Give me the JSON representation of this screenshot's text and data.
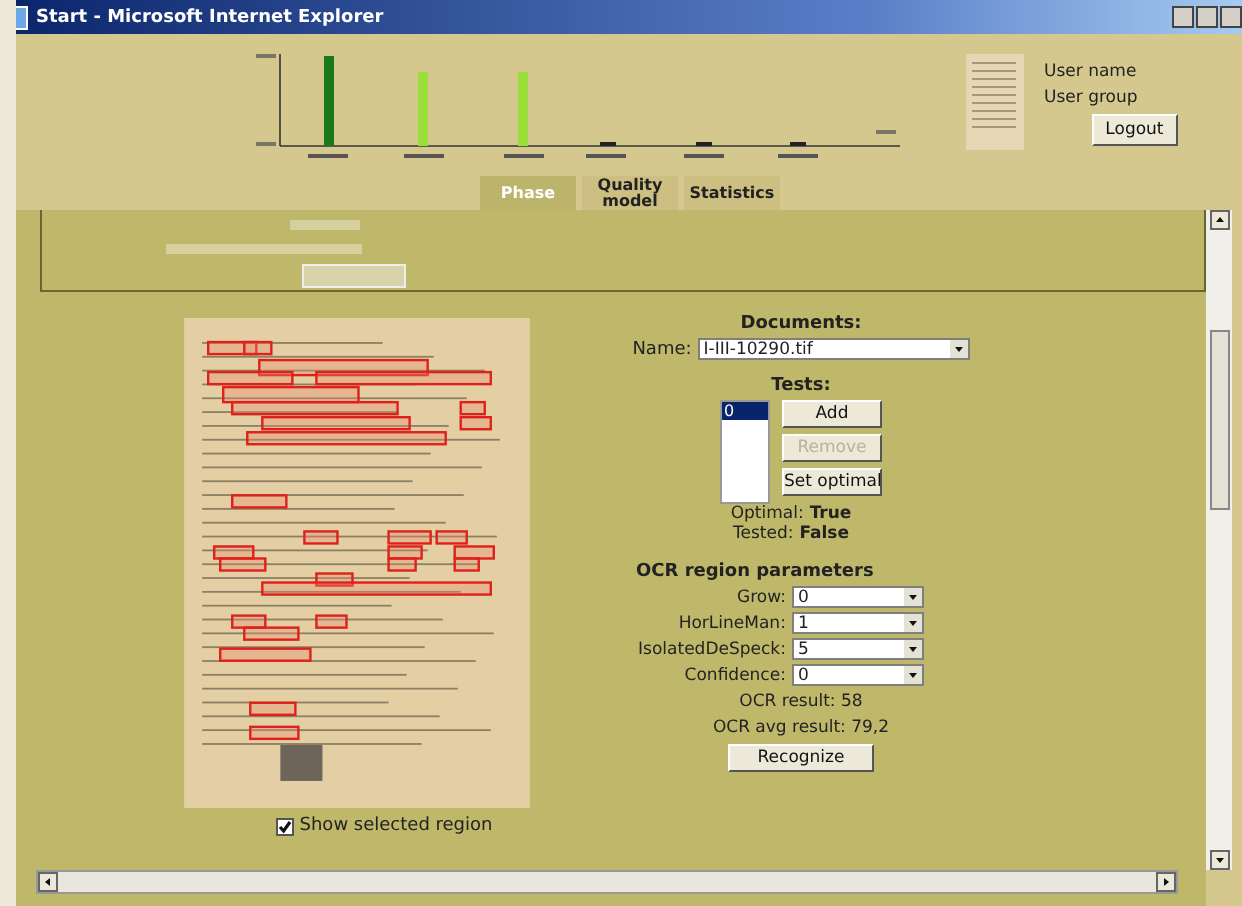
{
  "window": {
    "title": "Start - Microsoft Internet Explorer"
  },
  "header": {
    "user_name": "User name",
    "user_group": "User group",
    "logout": "Logout"
  },
  "tabs": [
    {
      "label": "Phase",
      "selected": true
    },
    {
      "label": "Quality model",
      "selected": false
    },
    {
      "label": "Statistics",
      "selected": false
    }
  ],
  "documents": {
    "heading": "Documents:",
    "name_label": "Name:",
    "name_value": "I-III-10290.tif"
  },
  "tests": {
    "heading": "Tests:",
    "items": [
      {
        "label": "0",
        "selected": true
      }
    ],
    "buttons": [
      {
        "label": "Add",
        "disabled": false
      },
      {
        "label": "Remove",
        "disabled": true
      },
      {
        "label": "Set optimal",
        "disabled": false
      }
    ],
    "optimal_label": "Optimal:",
    "optimal_value": "True",
    "tested_label": "Tested:",
    "tested_value": "False"
  },
  "ocr": {
    "heading": "OCR region parameters",
    "params": [
      {
        "label": "Grow:",
        "value": "0"
      },
      {
        "label": "HorLineMan:",
        "value": "1"
      },
      {
        "label": "IsolatedDeSpeck:",
        "value": "5"
      },
      {
        "label": "Confidence:",
        "value": "0"
      }
    ],
    "result": "OCR result: 58",
    "avg_result": "OCR avg result: 79,2",
    "recognize": "Recognize"
  },
  "show_region": {
    "label": "Show selected region",
    "checked": true
  }
}
